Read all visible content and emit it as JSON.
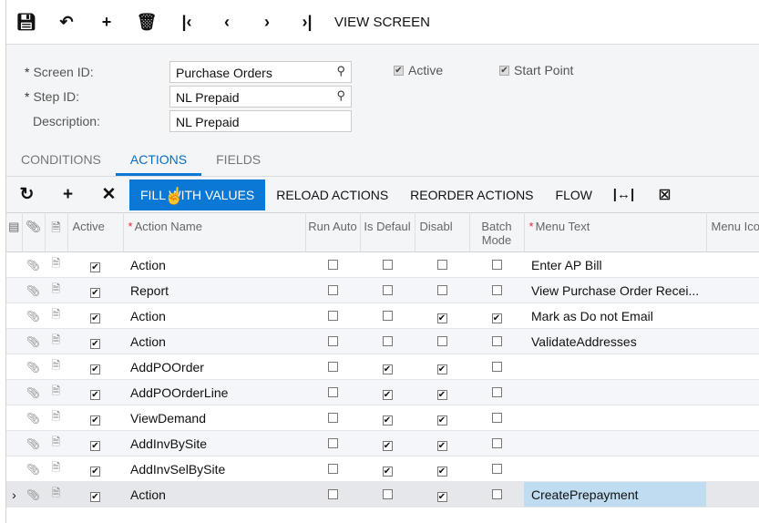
{
  "toolbar": {
    "icons": [
      "save-icon",
      "undo-icon",
      "add-icon",
      "delete-icon",
      "first-icon",
      "prev-icon",
      "next-icon",
      "last-icon"
    ],
    "view_screen": "VIEW SCREEN"
  },
  "form": {
    "screen_id_label": "Screen ID:",
    "screen_id": "Purchase Orders",
    "step_id_label": "Step ID:",
    "step_id": "NL Prepaid",
    "description_label": "Description:",
    "description": "NL Prepaid",
    "active_label": "Active",
    "active": true,
    "start_point_label": "Start Point",
    "start_point": true
  },
  "tabs": [
    "CONDITIONS",
    "ACTIONS",
    "FIELDS"
  ],
  "active_tab": "ACTIONS",
  "grid_toolbar": {
    "fill": "FILL WITH VALUES",
    "reload": "RELOAD ACTIONS",
    "reorder": "REORDER ACTIONS",
    "flow": "FLOW"
  },
  "columns": {
    "active": "Active",
    "action_name": "Action Name",
    "run_auto": "Run Auto",
    "is_default": "Is Defaul",
    "disabled": "Disabl",
    "batch": "Batch Mode",
    "menu_text": "Menu Text",
    "menu_icon": "Menu Ico"
  },
  "rows": [
    {
      "active": true,
      "name": "Action",
      "run_auto": false,
      "is_default": false,
      "disabled": false,
      "batch": false,
      "menu_text": "Enter AP Bill"
    },
    {
      "active": true,
      "name": "Report",
      "run_auto": false,
      "is_default": false,
      "disabled": false,
      "batch": false,
      "menu_text": "View Purchase Order Recei..."
    },
    {
      "active": true,
      "name": "Action",
      "run_auto": false,
      "is_default": false,
      "disabled": true,
      "batch": true,
      "menu_text": "Mark as Do not Email"
    },
    {
      "active": true,
      "name": "Action",
      "run_auto": false,
      "is_default": false,
      "disabled": false,
      "batch": false,
      "menu_text": "ValidateAddresses"
    },
    {
      "active": true,
      "name": "AddPOOrder",
      "run_auto": false,
      "is_default": true,
      "disabled": true,
      "batch": false,
      "menu_text": ""
    },
    {
      "active": true,
      "name": "AddPOOrderLine",
      "run_auto": false,
      "is_default": true,
      "disabled": true,
      "batch": false,
      "menu_text": ""
    },
    {
      "active": true,
      "name": "ViewDemand",
      "run_auto": false,
      "is_default": true,
      "disabled": true,
      "batch": false,
      "menu_text": ""
    },
    {
      "active": true,
      "name": "AddInvBySite",
      "run_auto": false,
      "is_default": true,
      "disabled": true,
      "batch": false,
      "menu_text": ""
    },
    {
      "active": true,
      "name": "AddInvSelBySite",
      "run_auto": false,
      "is_default": true,
      "disabled": true,
      "batch": false,
      "menu_text": ""
    },
    {
      "active": true,
      "name": "Action",
      "run_auto": false,
      "is_default": false,
      "disabled": true,
      "batch": false,
      "menu_text": "CreatePrepayment",
      "selected": true
    }
  ],
  "colors": {
    "accent": "#0a78d4",
    "selected_cell": "#bfdcf1"
  }
}
